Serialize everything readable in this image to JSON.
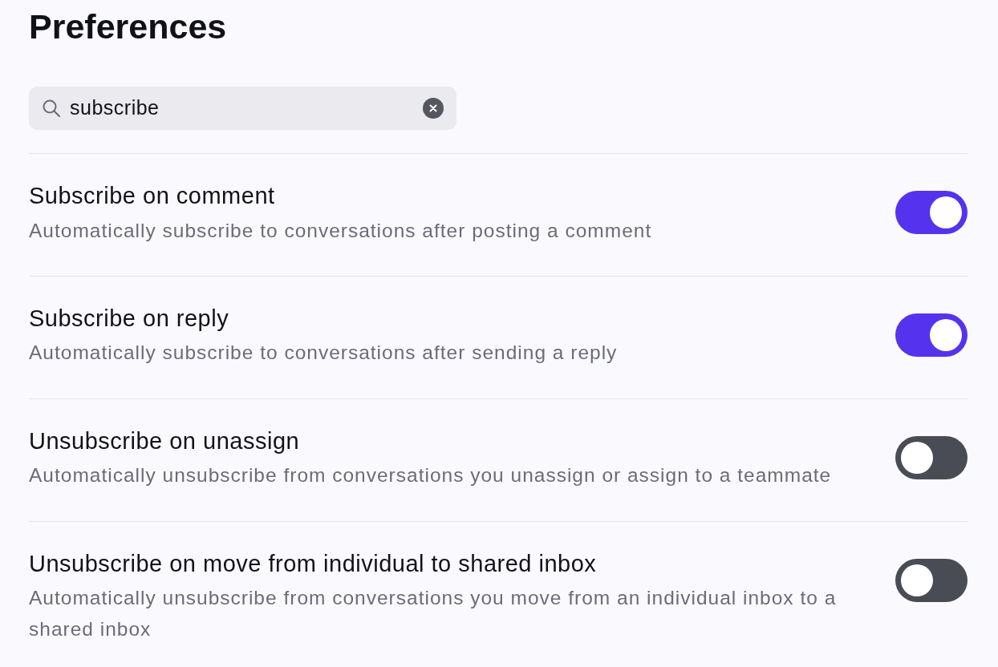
{
  "title": "Preferences",
  "search": {
    "value": "subscribe"
  },
  "settings": [
    {
      "label": "Subscribe on comment",
      "description": "Automatically subscribe to conversations after posting a comment",
      "on": true
    },
    {
      "label": "Subscribe on reply",
      "description": "Automatically subscribe to conversations after sending a reply",
      "on": true
    },
    {
      "label": "Unsubscribe on unassign",
      "description": "Automatically unsubscribe from conversations you unassign or assign to a teammate",
      "on": false
    },
    {
      "label": "Unsubscribe on move from individual to shared inbox",
      "description": "Automatically unsubscribe from conversations you move from an individual inbox to a shared inbox",
      "on": false
    }
  ]
}
